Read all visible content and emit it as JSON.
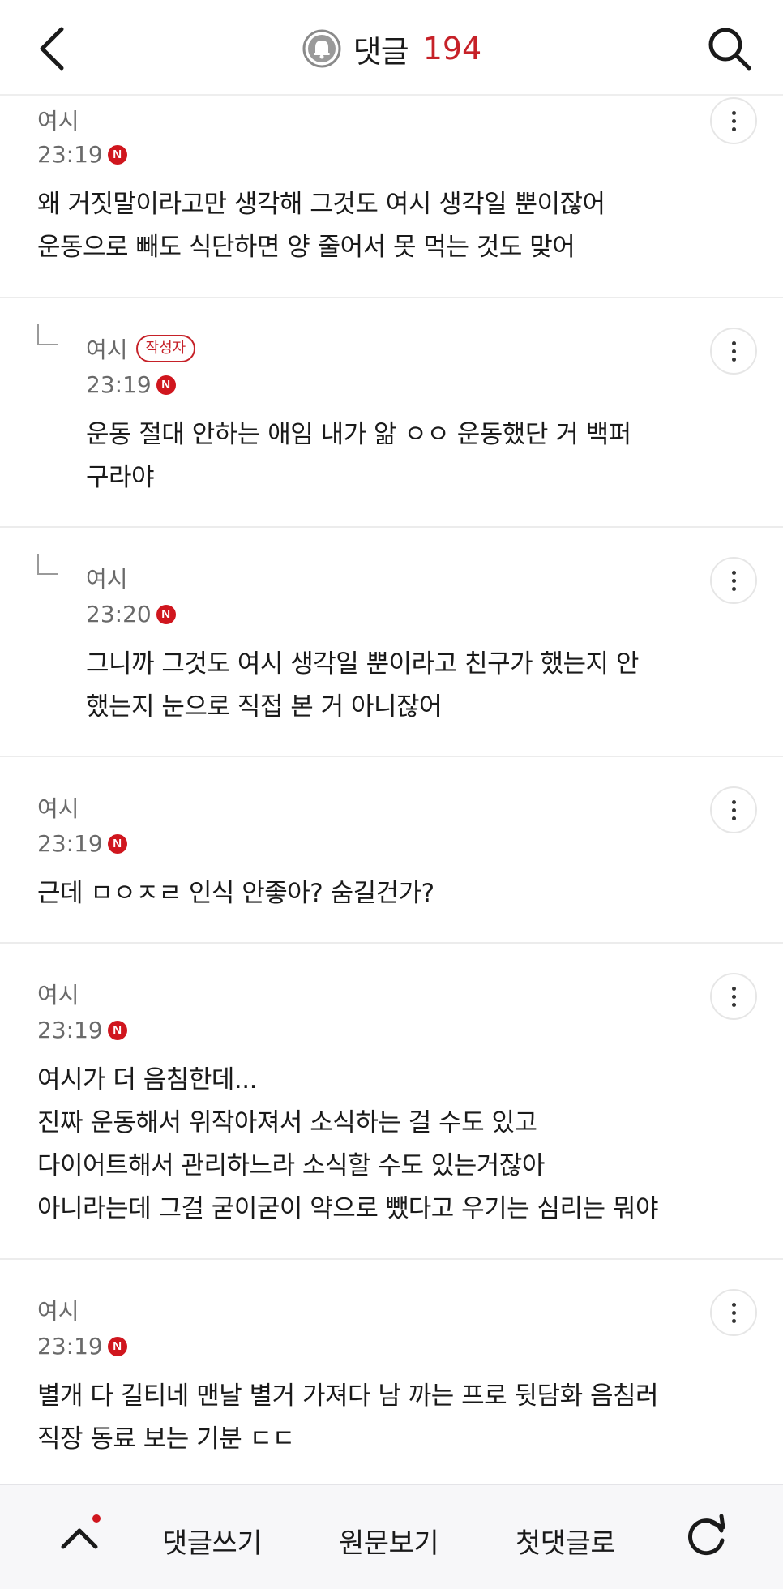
{
  "header": {
    "title": "댓글",
    "count": "194"
  },
  "comments": [
    {
      "author": "여시",
      "time": "23:19",
      "time_badge": "N",
      "lines": [
        "왜 거짓말이라고만 생각해 그것도 여시 생각일 뿐이잖어",
        "운동으로 빼도 식단하면 양 줄어서 못 먹는 것도 맞어"
      ]
    },
    {
      "author": "여시",
      "badge": "작성자",
      "time": "23:19",
      "time_badge": "N",
      "lines": [
        "운동 절대 안하는 애임 내가 앎 ㅇㅇ 운동했단 거 백퍼",
        "구라야"
      ]
    },
    {
      "author": "여시",
      "time": "23:20",
      "time_badge": "N",
      "lines": [
        "그니까 그것도 여시 생각일 뿐이라고 친구가 했는지 안",
        "했는지 눈으로 직접 본 거 아니잖어"
      ]
    },
    {
      "author": "여시",
      "time": "23:19",
      "time_badge": "N",
      "lines": [
        "근데 ㅁㅇㅈㄹ 인식 안좋아? 숨길건가?"
      ]
    },
    {
      "author": "여시",
      "time": "23:19",
      "time_badge": "N",
      "lines": [
        "여시가 더 음침한데...",
        "진짜 운동해서 위작아져서 소식하는 걸 수도 있고",
        "다이어트해서 관리하느라 소식할 수도 있는거잖아",
        "아니라는데 그걸 굳이굳이 약으로 뺐다고 우기는 심리는 뭐야"
      ]
    },
    {
      "author": "여시",
      "time": "23:19",
      "time_badge": "N",
      "lines": [
        "별개 다 길티네 맨날 별거 가져다 남 까는 프로 뒷담화 음침러",
        "직장 동료 보는 기분 ㄷㄷ"
      ]
    }
  ],
  "bottom_bar": {
    "write": "댓글쓰기",
    "original": "원문보기",
    "first": "첫댓글로"
  },
  "colors": {
    "accent": "#c62128",
    "text": "#1a1a1a",
    "muted": "#6a6a6a"
  },
  "icons": {
    "back": "chevron-left-icon",
    "bell": "bell-icon",
    "search": "search-icon",
    "more": "more-vertical-icon",
    "up": "chevron-up-icon",
    "refresh": "refresh-icon"
  }
}
